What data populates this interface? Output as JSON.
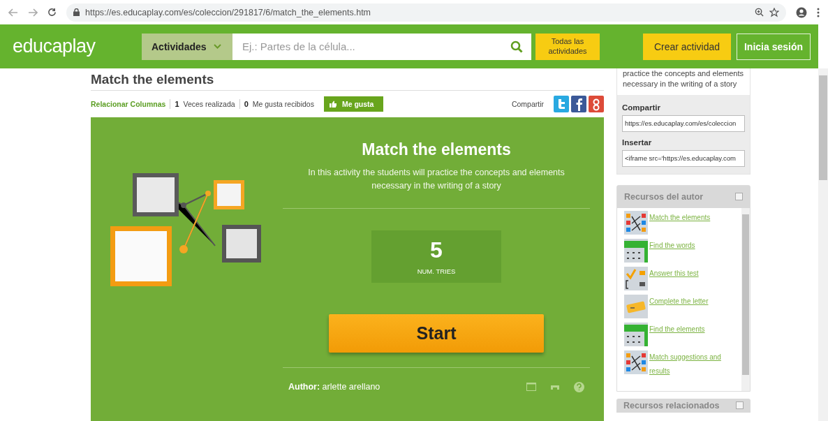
{
  "browser": {
    "url": "https://es.educaplay.com/es/coleccion/291817/6/match_the_elements.htm"
  },
  "header": {
    "logo": "educaplay",
    "category_button": "Actividades",
    "search": {
      "placeholder": "Ej.: Partes de la célula..."
    },
    "all_button": "Todas las actividades",
    "create_button": "Crear actividad",
    "login_button": "Inicia sesión"
  },
  "activity": {
    "title": "Match the elements",
    "type_link": "Relacionar Columnas",
    "times_count": "1",
    "times_label": "Veces realizada",
    "likes_count": "0",
    "likes_label": "Me gusta recibidos",
    "like_button": "Me gusta",
    "share_label": "Compartir",
    "panel": {
      "title": "Match the elements",
      "description": "In this activity the students will practice the concepts and elements necessary in the writing of a story",
      "tries": "5",
      "tries_label": "NUM. TRIES",
      "start_button": "Start",
      "author_label": "Author:",
      "author": "arlette arellano"
    }
  },
  "sidebar": {
    "description": "practice the concepts and elements necessary in the writing of a story",
    "share_label": "Compartir",
    "share_value": "https://es.educaplay.com/es/coleccion",
    "embed_label": "Insertar",
    "embed_value": "<iframe src='https://es.educaplay.com",
    "author_resources": {
      "title": "Recursos del autor",
      "items": [
        {
          "label": "Match the elements",
          "kind": "match"
        },
        {
          "label": "Find the words",
          "kind": "words"
        },
        {
          "label": "Answer this test",
          "kind": "test"
        },
        {
          "label": "Complete the letter",
          "kind": "letter"
        },
        {
          "label": "Find the elements",
          "kind": "words"
        },
        {
          "label": "Match suggestions and results",
          "kind": "match"
        }
      ]
    },
    "related_title": "Recursos relacionados"
  }
}
